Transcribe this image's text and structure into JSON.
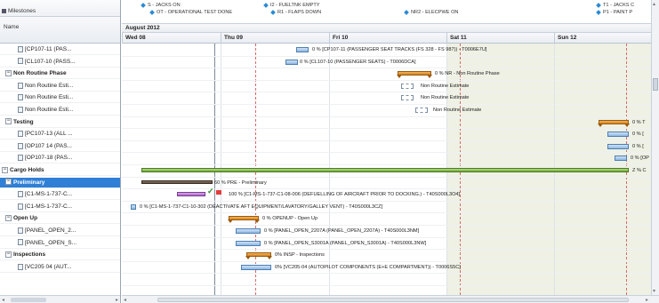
{
  "tree": {
    "milestones_label": "Milestones",
    "name_header": "Name",
    "rows": [
      {
        "label": "[CP107-11 (PAS...",
        "type": "task"
      },
      {
        "label": "[CL107-10 (PASS...",
        "type": "task"
      },
      {
        "label": "Non Routine Phase",
        "type": "group"
      },
      {
        "label": "Non Routine Esti...",
        "type": "task"
      },
      {
        "label": "Non Routine Esti...",
        "type": "task"
      },
      {
        "label": "Non Routine Esti...",
        "type": "task"
      },
      {
        "label": "Testing",
        "type": "group"
      },
      {
        "label": "[PC107-13 (ALL ...",
        "type": "task"
      },
      {
        "label": "[OP107 14 (PAS...",
        "type": "task"
      },
      {
        "label": "[OP107-18 (PAS...",
        "type": "task"
      },
      {
        "label": "Cargo Holds",
        "type": "group"
      },
      {
        "label": "Preliminary",
        "type": "selected"
      },
      {
        "label": "[C1-MS-1-737-C...",
        "type": "task"
      },
      {
        "label": "[C1-MS-1-737-C...",
        "type": "task"
      },
      {
        "label": "Open Up",
        "type": "group"
      },
      {
        "label": "[PANEL_OPEN_2...",
        "type": "task"
      },
      {
        "label": "[PANEL_OPEN_S...",
        "type": "task"
      },
      {
        "label": "Inspections",
        "type": "group"
      },
      {
        "label": "[VC205 04 (AUT...",
        "type": "task"
      }
    ]
  },
  "milestones": [
    {
      "label": "S - JACKS ON"
    },
    {
      "label": "OT - OPERATIONAL TEST DONE"
    },
    {
      "label": "I2 - FUELTNK EMPTY"
    },
    {
      "label": "R1 - FLAPS DOWN"
    },
    {
      "label": "NR2 - ELECPWE ON"
    },
    {
      "label": "T1 - JACKS C"
    },
    {
      "label": "P1 - PAINT P"
    }
  ],
  "timeline": {
    "month": "August 2012",
    "days": [
      "Wed 08",
      "Thu 09",
      "Fri 10",
      "Sat 11",
      "Sun 12"
    ]
  },
  "bars": {
    "b0": "0 %  [CP107-11 (PASSENGER SEAT TRACKS (FS 328 - FS 987)) - T0006E7U]",
    "b1": "0 %  [CL107-10 (PASSENGER SEATS) - T0006DCA]",
    "b2": "0 %  NR - Non Routine Phase",
    "b3": "Non Routine Estimate",
    "b4": "Non Routine Estimate",
    "b5": "Non Routine Estimate",
    "b6": "0 %  T",
    "b7": "0 %  [",
    "b8": "0 %  [",
    "b9": "0 %  [OP",
    "b10": "Z % C",
    "b11": "60 %  PRE - Preliminary",
    "b12": "100 %  [C1-MS-1-737-C1-08-006 (DEFUELLING OF AIRCRAFT PRIOR TO DOCKING.) - T40S000L3O4]",
    "b13": "0 %  [C1-MS-1-737-C1-10-302 (DEACTIVATE AFT EQUIPMENT/LAVATORY/GALLEY VENT) - T40S000L3CZ]",
    "b14": "0 %  OPENUP - Open Up",
    "b15": "0 %  [PANEL_OPEN_2207A (PANEL_OPEN_2207A) - T40S000L3NM]",
    "b16": "0 %  [PANEL_OPEN_S3001A (PANEL_OPEN_S3001A) - T40S000L3NW]",
    "b17": "0%  INSP - Inspections",
    "b18": "0%  [VC205-04 (AUTOPILOT COMPONENTS (E+E COMPARTMENT)) - T0006S5C]"
  },
  "colors": {
    "selection": "#2f7fd6",
    "summary_bar": "#d4821e",
    "task_bar": "#8fb8e2",
    "cargo_bar": "#6ea33a",
    "milestone_diamond": "#2a8ad4",
    "weekend_shade": "#eef1e4"
  }
}
